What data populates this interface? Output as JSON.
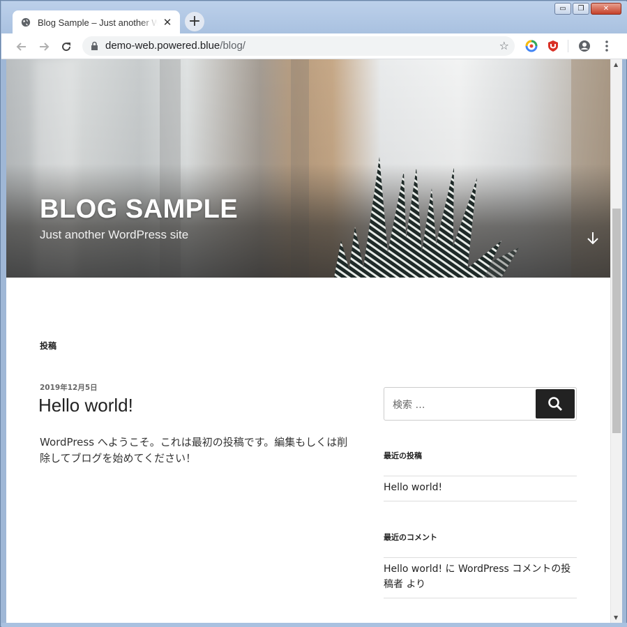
{
  "browser": {
    "tab_title": "Blog Sample – Just another WordPress site",
    "new_tab_label": "+",
    "close_tab_label": "✕",
    "url_host": "demo-web.powered.blue",
    "url_path": "/blog/",
    "bookmark_star": "☆"
  },
  "window_controls": {
    "minimize": "▭",
    "maximize": "❐",
    "close": "✕"
  },
  "site": {
    "title": "BLOG SAMPLE",
    "description": "Just another WordPress site"
  },
  "main": {
    "section_label": "投稿",
    "post": {
      "date": "2019年12月5日",
      "title": "Hello world!",
      "body": "WordPress へようこそ。これは最初の投稿です。編集もしくは削除してブログを始めてください！"
    }
  },
  "sidebar": {
    "search_placeholder": "検索 …",
    "recent_posts_title": "最近の投稿",
    "recent_posts": [
      "Hello world!"
    ],
    "recent_comments_title": "最近のコメント",
    "recent_comments": [
      "Hello world! に WordPress コメントの投稿者 より"
    ]
  },
  "colors": {
    "search_button": "#222222",
    "extension_green": "#3fa34d",
    "extension_red": "#d93025"
  }
}
